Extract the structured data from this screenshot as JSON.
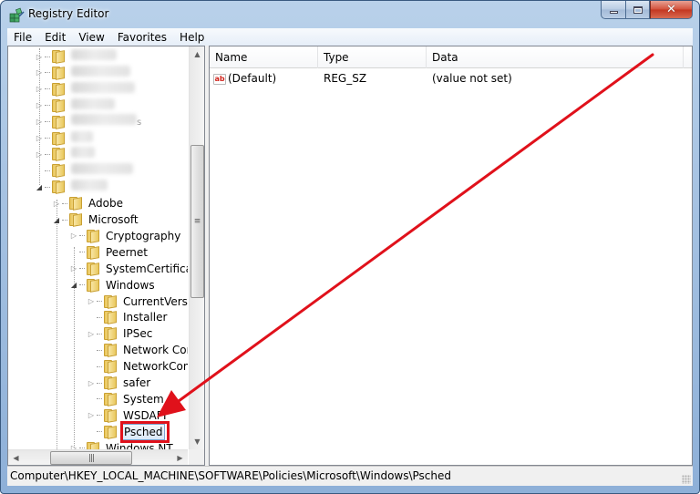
{
  "window": {
    "title": "Registry Editor",
    "app_icon": "registry-editor-icon",
    "buttons": {
      "minimize": "minimize-icon",
      "maximize": "maximize-icon",
      "close": "close-icon"
    }
  },
  "menu": [
    "File",
    "Edit",
    "View",
    "Favorites",
    "Help"
  ],
  "tree": {
    "blurred_items": [
      {
        "expander": "collapsed",
        "width": 50
      },
      {
        "expander": "collapsed",
        "width": 65
      },
      {
        "expander": "collapsed",
        "width": 70
      },
      {
        "expander": "collapsed",
        "width": 48
      },
      {
        "expander": "collapsed",
        "width": 72,
        "suffix": "s"
      },
      {
        "expander": "collapsed",
        "width": 24
      },
      {
        "expander": "collapsed",
        "width": 26
      },
      {
        "expander": "none",
        "width": 68
      },
      {
        "expander": "expanded",
        "width": 40
      }
    ],
    "items": [
      {
        "label": "Adobe",
        "level": 1,
        "expander": "collapsed"
      },
      {
        "label": "Microsoft",
        "level": 1,
        "expander": "expanded"
      },
      {
        "label": "Cryptography",
        "level": 2,
        "expander": "collapsed"
      },
      {
        "label": "Peernet",
        "level": 2,
        "expander": "none"
      },
      {
        "label": "SystemCertificates",
        "level": 2,
        "expander": "collapsed"
      },
      {
        "label": "Windows",
        "level": 2,
        "expander": "expanded"
      },
      {
        "label": "CurrentVersion",
        "level": 3,
        "expander": "collapsed"
      },
      {
        "label": "Installer",
        "level": 3,
        "expander": "none"
      },
      {
        "label": "IPSec",
        "level": 3,
        "expander": "collapsed"
      },
      {
        "label": "Network Conne",
        "level": 3,
        "expander": "none"
      },
      {
        "label": "NetworkConnec",
        "level": 3,
        "expander": "none"
      },
      {
        "label": "safer",
        "level": 3,
        "expander": "collapsed"
      },
      {
        "label": "System",
        "level": 3,
        "expander": "none"
      },
      {
        "label": "WSDAPI",
        "level": 3,
        "expander": "collapsed"
      },
      {
        "label": "Psched",
        "level": 3,
        "expander": "none",
        "selected": true
      },
      {
        "label": "Windows NT",
        "level": 2,
        "expander": "collapsed"
      }
    ],
    "vscroll_position": 0.38,
    "hscroll_position": 0.0,
    "scroll_arrows": {
      "up": "▲",
      "down": "▼",
      "left": "◀",
      "right": "▶"
    },
    "thumb_grip": "≡",
    "hthumb_grip": "|||"
  },
  "list": {
    "columns": [
      "Name",
      "Type",
      "Data"
    ],
    "rows": [
      {
        "icon": "ab",
        "name": "(Default)",
        "type": "REG_SZ",
        "data": "(value not set)"
      }
    ]
  },
  "statusbar": {
    "path": "Computer\\HKEY_LOCAL_MACHINE\\SOFTWARE\\Policies\\Microsoft\\Windows\\Psched"
  },
  "annotation": {
    "color": "#e0111b",
    "target": "Psched"
  }
}
